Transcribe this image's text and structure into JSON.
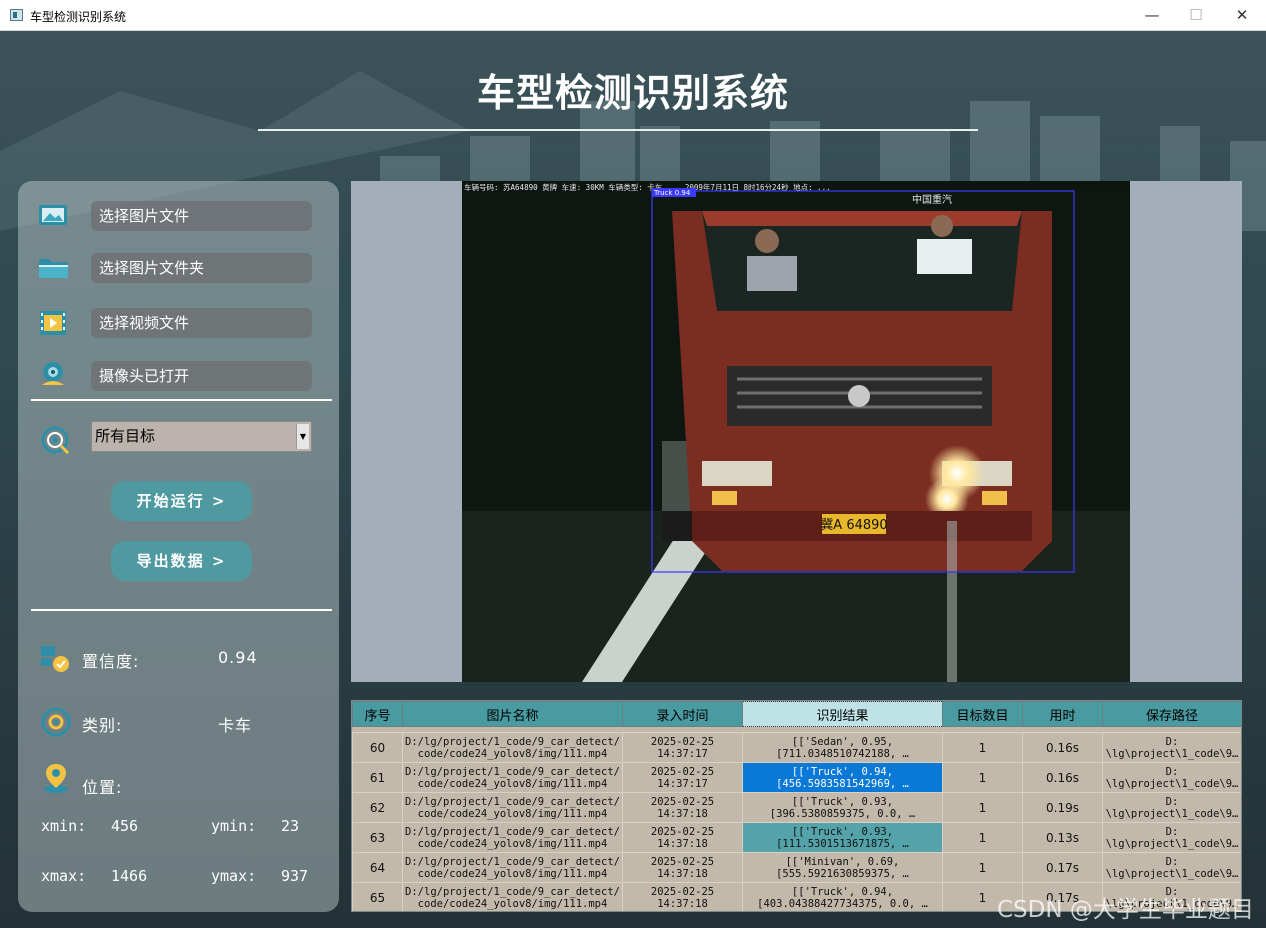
{
  "window": {
    "title": "车型检测识别系统",
    "minimize": "—",
    "maximize": "☐",
    "close": "✕"
  },
  "header": {
    "title": "车型检测识别系统"
  },
  "sidebar": {
    "buttons": [
      {
        "label": "选择图片文件",
        "icon": "image-file-icon"
      },
      {
        "label": "选择图片文件夹",
        "icon": "folder-icon"
      },
      {
        "label": "选择视频文件",
        "icon": "video-file-icon"
      },
      {
        "label": "摄像头已打开",
        "icon": "camera-icon"
      }
    ],
    "target_select": {
      "value": "所有目标",
      "icon": "target-icon"
    },
    "run_button": "开始运行 >",
    "export_button": "导出数据 >",
    "confidence_label": "置信度:",
    "confidence_value": "0.94",
    "class_label": "类别:",
    "class_value": "卡车",
    "position_label": "位置:",
    "xmin_label": "xmin:",
    "xmin_value": "456",
    "ymin_label": "ymin:",
    "ymin_value": "23",
    "xmax_label": "xmax:",
    "xmax_value": "1466",
    "ymax_label": "ymax:",
    "ymax_value": "937"
  },
  "viewer": {
    "overlay_text": "车辆号码: 苏A64890 黄牌  车速: 30KM  车辆类型: 卡车 ... 2009年7月11日 8时16分24秒  地点: ...",
    "detection_label": "Truck 0.94",
    "plate": "冀A 64890",
    "cab_text": "中国重汽"
  },
  "table": {
    "headers": [
      "序号",
      "图片名称",
      "录入时间",
      "识别结果",
      "目标数目",
      "用时",
      "保存路径"
    ],
    "rows": [
      {
        "id": "60",
        "name1": "D:/lg/project/1_code/9_car_detect/",
        "name2": "code/code24_yolov8/img/111.mp4",
        "date": "2025-02-25",
        "time": "14:37:17",
        "res1": "[['Sedan', 0.95,",
        "res2": "[711.0348510742188, …",
        "count": "1",
        "dur": "0.16s",
        "path1": "D:",
        "path2": "\\lg\\project\\1_code\\9…",
        "state": ""
      },
      {
        "id": "61",
        "name1": "D:/lg/project/1_code/9_car_detect/",
        "name2": "code/code24_yolov8/img/111.mp4",
        "date": "2025-02-25",
        "time": "14:37:17",
        "res1": "[['Truck', 0.94,",
        "res2": "[456.5983581542969, …",
        "count": "1",
        "dur": "0.16s",
        "path1": "D:",
        "path2": "\\lg\\project\\1_code\\9…",
        "state": "sel-blue"
      },
      {
        "id": "62",
        "name1": "D:/lg/project/1_code/9_car_detect/",
        "name2": "code/code24_yolov8/img/111.mp4",
        "date": "2025-02-25",
        "time": "14:37:18",
        "res1": "[['Truck', 0.93,",
        "res2": "[396.5380859375, 0.0, …",
        "count": "1",
        "dur": "0.19s",
        "path1": "D:",
        "path2": "\\lg\\project\\1_code\\9…",
        "state": ""
      },
      {
        "id": "63",
        "name1": "D:/lg/project/1_code/9_car_detect/",
        "name2": "code/code24_yolov8/img/111.mp4",
        "date": "2025-02-25",
        "time": "14:37:18",
        "res1": "[['Truck', 0.93,",
        "res2": "[111.5301513671875, …",
        "count": "1",
        "dur": "0.13s",
        "path1": "D:",
        "path2": "\\lg\\project\\1_code\\9…",
        "state": "sel-teal"
      },
      {
        "id": "64",
        "name1": "D:/lg/project/1_code/9_car_detect/",
        "name2": "code/code24_yolov8/img/111.mp4",
        "date": "2025-02-25",
        "time": "14:37:18",
        "res1": "[['Minivan', 0.69,",
        "res2": "[555.5921630859375, …",
        "count": "1",
        "dur": "0.17s",
        "path1": "D:",
        "path2": "\\lg\\project\\1_code\\9…",
        "state": ""
      },
      {
        "id": "65",
        "name1": "D:/lg/project/1_code/9_car_detect/",
        "name2": "code/code24_yolov8/img/111.mp4",
        "date": "2025-02-25",
        "time": "14:37:18",
        "res1": "[['Truck', 0.94,",
        "res2": "[403.04388427734375, 0.0, …",
        "count": "1",
        "dur": "0.17s",
        "path1": "D:",
        "path2": "\\lg\\project\\1_code\\9…",
        "state": ""
      }
    ]
  },
  "watermark": "CSDN @大学生毕业题目"
}
